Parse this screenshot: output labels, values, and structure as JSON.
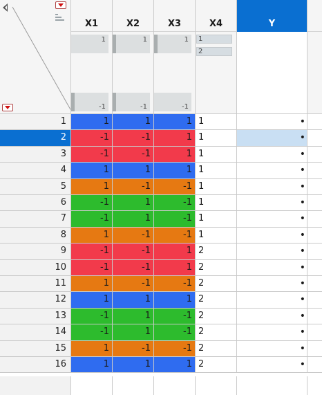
{
  "table": {
    "columns": [
      {
        "name": "X1",
        "kind": "numeric",
        "preview_max": "1",
        "preview_min": "-1"
      },
      {
        "name": "X2",
        "kind": "numeric",
        "preview_max": "1",
        "preview_min": "-1"
      },
      {
        "name": "X3",
        "kind": "numeric",
        "preview_max": "1",
        "preview_min": "-1"
      },
      {
        "name": "X4",
        "kind": "categorical",
        "levels": [
          "1",
          "2"
        ]
      },
      {
        "name": "Y",
        "kind": "numeric",
        "selected": true
      }
    ],
    "selected_row": 2,
    "rows": [
      {
        "n": "1",
        "x1": "1",
        "x2": "1",
        "x3": "1",
        "x4": "1",
        "y": "•",
        "color": "blue"
      },
      {
        "n": "2",
        "x1": "-1",
        "x2": "-1",
        "x3": "1",
        "x4": "1",
        "y": "•",
        "color": "red"
      },
      {
        "n": "3",
        "x1": "-1",
        "x2": "-1",
        "x3": "1",
        "x4": "1",
        "y": "•",
        "color": "red"
      },
      {
        "n": "4",
        "x1": "1",
        "x2": "1",
        "x3": "1",
        "x4": "1",
        "y": "•",
        "color": "blue"
      },
      {
        "n": "5",
        "x1": "1",
        "x2": "-1",
        "x3": "-1",
        "x4": "1",
        "y": "•",
        "color": "orange"
      },
      {
        "n": "6",
        "x1": "-1",
        "x2": "1",
        "x3": "-1",
        "x4": "1",
        "y": "•",
        "color": "green"
      },
      {
        "n": "7",
        "x1": "-1",
        "x2": "1",
        "x3": "-1",
        "x4": "1",
        "y": "•",
        "color": "green"
      },
      {
        "n": "8",
        "x1": "1",
        "x2": "-1",
        "x3": "-1",
        "x4": "1",
        "y": "•",
        "color": "orange"
      },
      {
        "n": "9",
        "x1": "-1",
        "x2": "-1",
        "x3": "1",
        "x4": "2",
        "y": "•",
        "color": "red"
      },
      {
        "n": "10",
        "x1": "-1",
        "x2": "-1",
        "x3": "1",
        "x4": "2",
        "y": "•",
        "color": "red"
      },
      {
        "n": "11",
        "x1": "1",
        "x2": "-1",
        "x3": "-1",
        "x4": "2",
        "y": "•",
        "color": "orange"
      },
      {
        "n": "12",
        "x1": "1",
        "x2": "1",
        "x3": "1",
        "x4": "2",
        "y": "•",
        "color": "blue"
      },
      {
        "n": "13",
        "x1": "-1",
        "x2": "1",
        "x3": "-1",
        "x4": "2",
        "y": "•",
        "color": "green"
      },
      {
        "n": "14",
        "x1": "-1",
        "x2": "1",
        "x3": "-1",
        "x4": "2",
        "y": "•",
        "color": "green"
      },
      {
        "n": "15",
        "x1": "1",
        "x2": "-1",
        "x3": "-1",
        "x4": "2",
        "y": "•",
        "color": "orange"
      },
      {
        "n": "16",
        "x1": "1",
        "x2": "1",
        "x3": "1",
        "x4": "2",
        "y": "•",
        "color": "blue"
      }
    ]
  },
  "colors": {
    "blue": "#2f6cf0",
    "red": "#f23a4b",
    "orange": "#e67912",
    "green": "#2dbb2d",
    "selection": "#0a6fd1",
    "selected_cell": "#c9dff3"
  },
  "icons": {
    "collapse": "triangle-left-icon",
    "menu": "red-dropdown-icon",
    "columns": "column-list-icon"
  }
}
